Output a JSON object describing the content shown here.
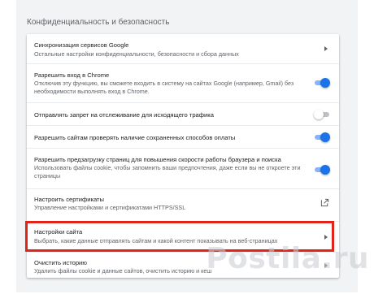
{
  "section": {
    "title": "Конфиденциальность и безопасность"
  },
  "rows": [
    {
      "title": "Синхронизация сервисов Google",
      "desc": "Остальные настройки конфиденциальности, безопасности и сбора данных",
      "control": "arrow"
    },
    {
      "title": "Разрешить вход в Chrome",
      "desc": "Отключив эту функцию, вы сможете входить в систему на сайтах Google (например, Gmail) без необходимости выполнять вход в Chrome.",
      "control": "toggle",
      "enabled": true
    },
    {
      "title": "Отправлять запрет на отслеживание для исходящего трафика",
      "control": "toggle",
      "enabled": false
    },
    {
      "title": "Разрешить сайтам проверять наличие сохраненных способов оплаты",
      "control": "toggle",
      "enabled": true
    },
    {
      "title": "Разрешить предзагрузку страниц для повышения скорости работы браузера и поиска",
      "desc": "Использовать файлы cookie, чтобы запомнить ваши предпочтения, даже если вы не откроете эти страницы",
      "control": "toggle",
      "enabled": true
    },
    {
      "title": "Настроить сертификаты",
      "desc": "Управление настройками и сертификатами HTTPS/SSL",
      "control": "external-link-icon"
    },
    {
      "title": "Настройки сайта",
      "desc": "Выбрать, какие данные отправлять сайтам и какой контент показывать на веб-страницах",
      "control": "arrow"
    },
    {
      "title": "Очистить историю",
      "desc": "Удалить файлы cookie и данные сайтов, очистить историю и кеш",
      "control": "arrow"
    }
  ],
  "colors": {
    "accent": "#1a73e8",
    "highlight": "#e2231a"
  },
  "watermark": {
    "text": "Postila.ru"
  }
}
